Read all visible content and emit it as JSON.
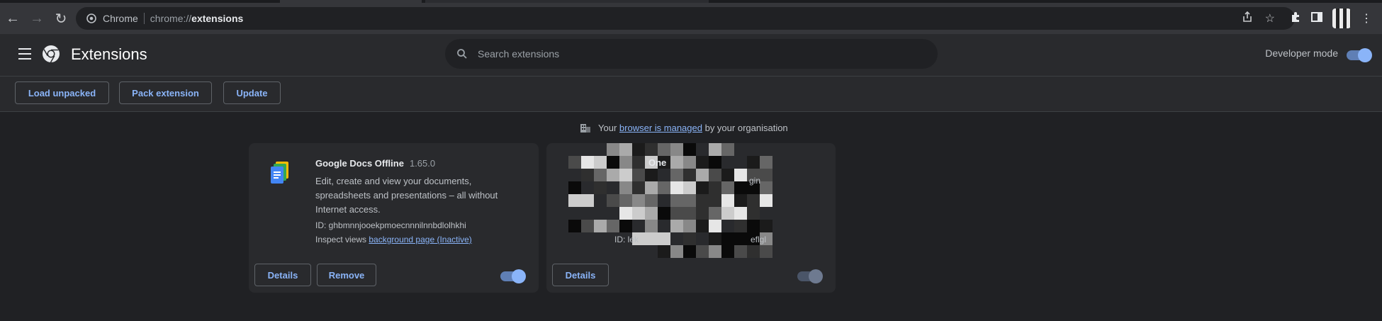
{
  "browser": {
    "omnibox_site_label": "Chrome",
    "omnibox_url_prefix": "chrome://",
    "omnibox_url_path": "extensions"
  },
  "header": {
    "title": "Extensions",
    "search_placeholder": "Search extensions",
    "developer_mode_label": "Developer mode",
    "developer_mode_on": true
  },
  "actions": {
    "load_unpacked": "Load unpacked",
    "pack_extension": "Pack extension",
    "update": "Update"
  },
  "managed_notice": {
    "prefix": "Your",
    "link": "browser is managed",
    "suffix": "by your organisation"
  },
  "extensions": [
    {
      "name": "Google Docs Offline",
      "version": "1.65.0",
      "description": "Edit, create and view your documents, spreadsheets and presentations – all without Internet access.",
      "id_label": "ID: ghbmnnjooekpmoecnnnilnnbdlolhkhi",
      "inspect_prefix": "Inspect views",
      "inspect_link": "background page (Inactive)",
      "details_label": "Details",
      "remove_label": "Remove",
      "enabled": true
    },
    {
      "name_partial": "One",
      "desc_partial": "gin",
      "id_partial_start": "ID: lek",
      "id_partial_end": "eflgl",
      "details_label": "Details",
      "enabled": true,
      "redacted": true
    }
  ],
  "colors": {
    "page_bg": "#202124",
    "surface": "#292a2d",
    "accent": "#8ab4f8",
    "toolbar": "#35363a"
  }
}
